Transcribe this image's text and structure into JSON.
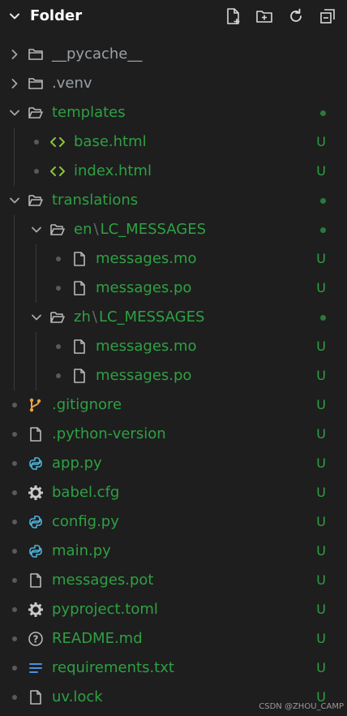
{
  "header": {
    "title": "Folder",
    "actions": [
      "new-file-icon",
      "new-folder-icon",
      "refresh-icon",
      "collapse-all-icon"
    ]
  },
  "tree": [
    {
      "label": "__pycache__",
      "type": "folder",
      "expanded": false,
      "status": "",
      "color": "#9aa0a6"
    },
    {
      "label": ".venv",
      "type": "folder",
      "expanded": false,
      "status": "",
      "color": "#9aa0a6"
    },
    {
      "label": "templates",
      "type": "folder",
      "expanded": true,
      "status": "dot"
    },
    {
      "label": "base.html",
      "type": "html",
      "status": "U"
    },
    {
      "label": "index.html",
      "type": "html",
      "status": "U"
    },
    {
      "label": "translations",
      "type": "folder",
      "expanded": true,
      "status": "dot"
    },
    {
      "label": "en",
      "label2": "LC_MESSAGES",
      "type": "folder",
      "expanded": true,
      "status": "dot"
    },
    {
      "label": "messages.mo",
      "type": "file",
      "status": "U"
    },
    {
      "label": "messages.po",
      "type": "file",
      "status": "U"
    },
    {
      "label": "zh",
      "label2": "LC_MESSAGES",
      "type": "folder",
      "expanded": true,
      "status": "dot"
    },
    {
      "label": "messages.mo",
      "type": "file",
      "status": "U"
    },
    {
      "label": "messages.po",
      "type": "file",
      "status": "U"
    },
    {
      "label": ".gitignore",
      "type": "git",
      "status": "U"
    },
    {
      "label": ".python-version",
      "type": "file",
      "status": "U"
    },
    {
      "label": "app.py",
      "type": "python",
      "status": "U"
    },
    {
      "label": "babel.cfg",
      "type": "gear",
      "status": "U"
    },
    {
      "label": "config.py",
      "type": "python",
      "status": "U"
    },
    {
      "label": "main.py",
      "type": "python",
      "status": "U"
    },
    {
      "label": "messages.pot",
      "type": "file",
      "status": "U"
    },
    {
      "label": "pyproject.toml",
      "type": "gear",
      "status": "U"
    },
    {
      "label": "README.md",
      "type": "info",
      "status": "U"
    },
    {
      "label": "requirements.txt",
      "type": "list",
      "status": "U"
    },
    {
      "label": "uv.lock",
      "type": "file",
      "status": "U"
    }
  ],
  "watermark": "CSDN @ZHOU_CAMP"
}
